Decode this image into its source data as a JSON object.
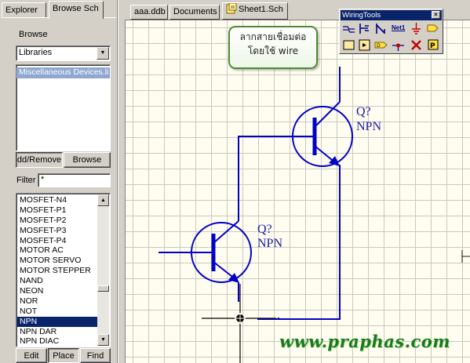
{
  "left_panel": {
    "tabs": [
      {
        "label": "Explorer"
      },
      {
        "label": "Browse Sch"
      }
    ],
    "browse_label": "Browse",
    "browse_select": "Libraries",
    "library_items": [
      "Miscellaneous Devices.li"
    ],
    "add_remove_label": "dd/Remove",
    "browse_button": "Browse",
    "filter_label": "Filter",
    "filter_value": "*",
    "components": [
      "MOSFET-N4",
      "MOSFET-P1",
      "MOSFET-P2",
      "MOSFET-P3",
      "MOSFET-P4",
      "MOTOR AC",
      "MOTOR SERVO",
      "MOTOR STEPPER",
      "NAND",
      "NEON",
      "NOR",
      "NOT",
      "NPN",
      "NPN DAR",
      "NPN DIAC"
    ],
    "selected_component": "NPN",
    "bottom_buttons": {
      "edit": "Edit",
      "place": "Place",
      "find": "Find"
    }
  },
  "doc_tabs": [
    {
      "label": "aaa.ddb"
    },
    {
      "label": "Documents"
    },
    {
      "label": "Sheet1.Sch"
    }
  ],
  "wiring_toolbar": {
    "title": "WiringTools",
    "close": "×",
    "net_label": "Net1"
  },
  "callout": {
    "line1": "ลากสายเชื่อมต่อ",
    "line2": "โดยใช้ wire"
  },
  "transistors": [
    {
      "designator": "Q?",
      "type": "NPN"
    },
    {
      "designator": "Q?",
      "type": "NPN"
    }
  ],
  "watermark": "www.praphas.com",
  "colors": {
    "wire": "#0000c8",
    "component": "#1a1aa8",
    "selection": "#0a246a",
    "sheet": "#fffdf0",
    "callout_border": "#4f8a38",
    "watermark": "#1a7a1a"
  }
}
